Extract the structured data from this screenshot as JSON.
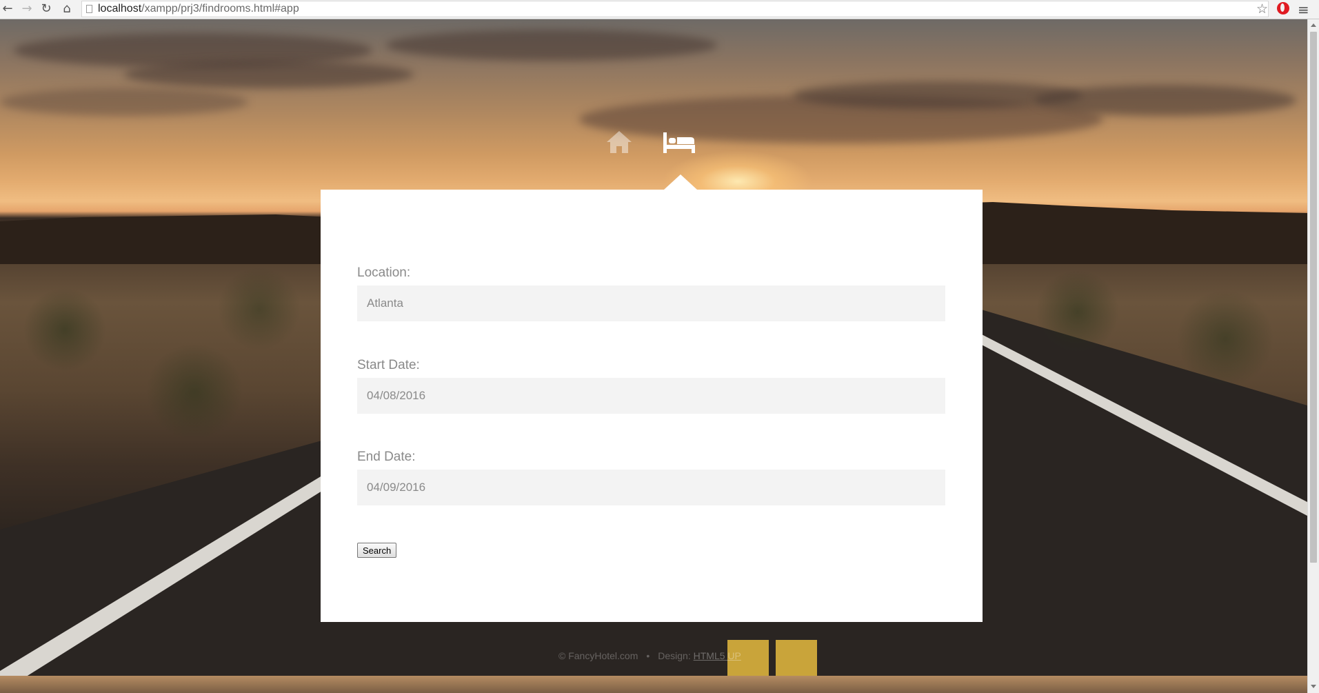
{
  "browser": {
    "url_host": "localhost",
    "url_path": "/xampp/prj3/findrooms.html#app"
  },
  "nav": {
    "icons": [
      "home-icon",
      "bed-icon"
    ],
    "active": "bed-icon"
  },
  "form": {
    "location": {
      "label": "Location:",
      "value": "Atlanta"
    },
    "start_date": {
      "label": "Start Date:",
      "value": "04/08/2016"
    },
    "end_date": {
      "label": "End Date:",
      "value": "04/09/2016"
    },
    "search_label": "Search"
  },
  "footer": {
    "copyright": "© FancyHotel.com",
    "separator": "•",
    "design_prefix": "Design:",
    "design_link": "HTML5 UP"
  },
  "colors": {
    "panel_bg": "#ffffff",
    "input_bg": "#f3f3f3",
    "label_text": "#8a8a8a"
  }
}
